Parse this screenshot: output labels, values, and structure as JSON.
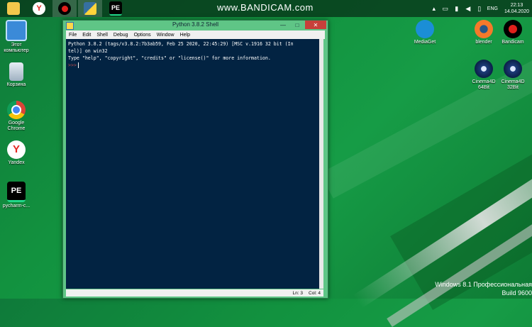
{
  "taskbar": {
    "watermark": "www.BANDICAM.com",
    "tray": {
      "language": "ENG",
      "time": "22:13",
      "date": "14.04.2020"
    }
  },
  "desktop": {
    "left_icons": [
      {
        "label": "Этот компьютер",
        "icon": "computer-icon"
      },
      {
        "label": "Корзина",
        "icon": "recycle-bin-icon"
      },
      {
        "label": "Google Chrome",
        "icon": "chrome-icon"
      },
      {
        "label": "Yandex",
        "icon": "yandex-icon"
      },
      {
        "label": "pycharm-c...",
        "icon": "pycharm-icon"
      }
    ],
    "right_icons": [
      {
        "label": "MediaGet",
        "icon": "mediaget-icon"
      },
      {
        "label": "blender",
        "icon": "blender-icon"
      },
      {
        "label": "Bandicam",
        "icon": "bandicam-icon"
      },
      {
        "label": "Cinema4D 64Bit",
        "icon": "cinema4d-icon"
      },
      {
        "label": "Cinema4D 32Bit",
        "icon": "cinema4d-icon"
      }
    ]
  },
  "window": {
    "title": "Python 3.8.2 Shell",
    "menu": [
      "File",
      "Edit",
      "Shell",
      "Debug",
      "Options",
      "Window",
      "Help"
    ],
    "lines": [
      "Python 3.8.2 (tags/v3.8.2:7b3ab59, Feb 25 2020, 22:45:29) [MSC v.1916 32 bit (In",
      "tel)] on win32",
      "Type \"help\", \"copyright\", \"credits\" or \"license()\" for more information."
    ],
    "prompt": ">>>",
    "status": {
      "line": "Ln: 3",
      "col": "Col: 4"
    }
  },
  "activation": {
    "line1": "Windows 8.1 Профессиональная",
    "line2": "Build 9600"
  },
  "colors": {
    "editor_bg": "#022342",
    "window_frame": "#5fc586",
    "desktop": "#12923f",
    "prompt": "#c14c4c"
  }
}
